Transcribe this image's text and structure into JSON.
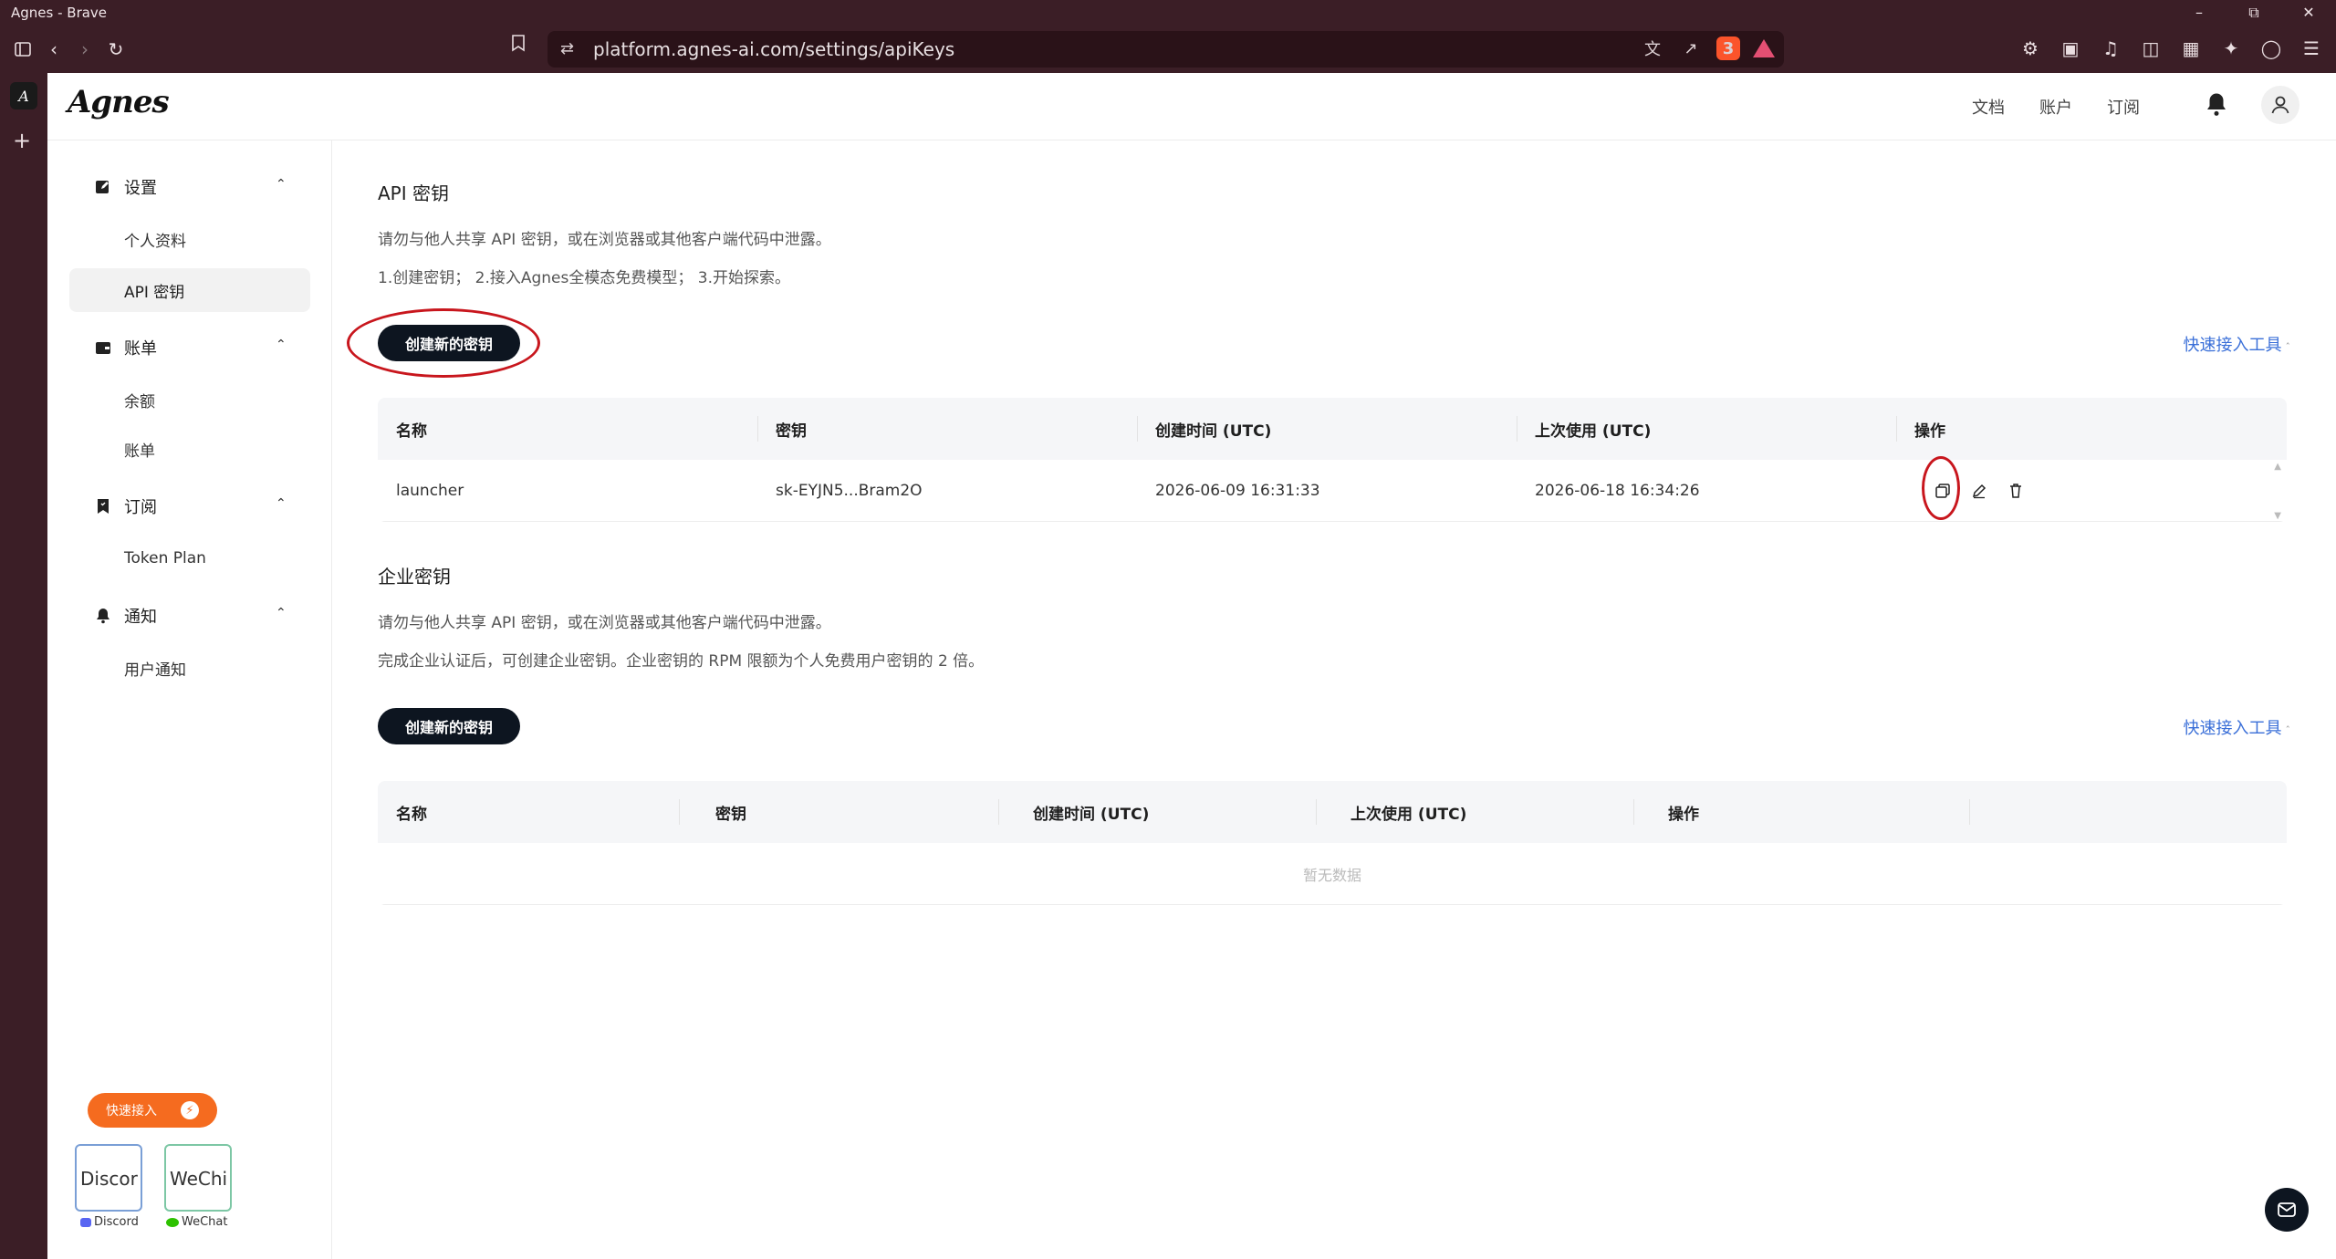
{
  "browser": {
    "window_title": "Agnes - Brave",
    "url": "platform.agnes-ai.com/settings/apiKeys",
    "shield_count": "3"
  },
  "header": {
    "logo": "Agnes",
    "nav": [
      "文档",
      "账户",
      "订阅"
    ]
  },
  "sidebar": {
    "groups": [
      {
        "title": "设置",
        "icon": "edit-square-icon",
        "items": [
          "个人资料",
          "API 密钥"
        ],
        "active": "API 密钥"
      },
      {
        "title": "账单",
        "icon": "wallet-icon",
        "items": [
          "余额",
          "账单"
        ]
      },
      {
        "title": "订阅",
        "icon": "bookmark-icon",
        "items": [
          "Token Plan"
        ]
      },
      {
        "title": "通知",
        "icon": "bell-icon",
        "items": [
          "用户通知"
        ]
      }
    ],
    "quick_access_label": "快速接入",
    "qr": [
      {
        "alt": "Discor",
        "caption": "Discord"
      },
      {
        "alt": "WeChi",
        "caption": "WeChat"
      }
    ]
  },
  "api_keys": {
    "title": "API 密钥",
    "desc1": "请勿与他人共享 API 密钥，或在浏览器或其他客户端代码中泄露。",
    "desc2": "1.创建密钥；  2.接入Agnes全模态免费模型；  3.开始探索。",
    "create_label": "创建新的密钥",
    "tool_link": "快速接入工具",
    "columns": [
      "名称",
      "密钥",
      "创建时间 (UTC)",
      "上次使用 (UTC)",
      "操作"
    ],
    "rows": [
      {
        "name": "launcher",
        "key": "sk-EYJN5...Bram2O",
        "created": "2026-06-09 16:31:33",
        "last_used": "2026-06-18 16:34:26"
      }
    ]
  },
  "enterprise_keys": {
    "title": "企业密钥",
    "desc1": "请勿与他人共享 API 密钥，或在浏览器或其他客户端代码中泄露。",
    "desc2": "完成企业认证后，可创建企业密钥。企业密钥的 RPM 限额为个人免费用户密钥的 2 倍。",
    "create_label": "创建新的密钥",
    "tool_link": "快速接入工具",
    "columns": [
      "名称",
      "密钥",
      "创建时间 (UTC)",
      "上次使用 (UTC)",
      "操作"
    ],
    "empty_text": "暂无数据"
  },
  "colors": {
    "chrome": "#3b1e26",
    "primary_button": "#0d1520",
    "link": "#3a6fd8",
    "quick_access": "#f56b1f",
    "annotation_ring": "#c8161d"
  }
}
